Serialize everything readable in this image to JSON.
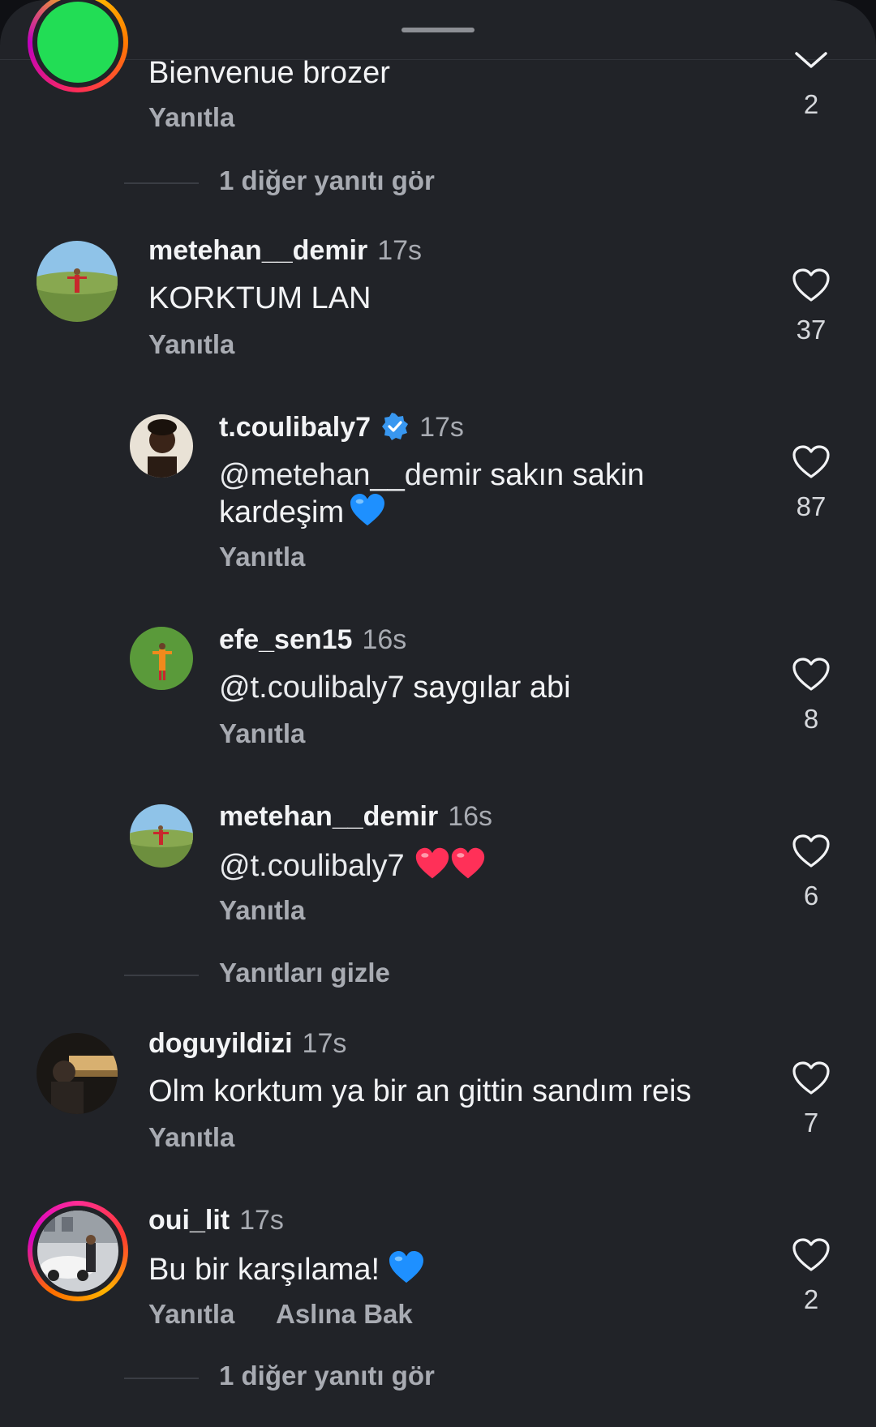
{
  "sheet": {
    "background": "#212328"
  },
  "colors": {
    "secondary_text": "#a8abb2",
    "verified_blue": "#3897f0",
    "heart_red": "#ff3040",
    "heart_blue": "#1e90ff"
  },
  "top_comment": {
    "text": "Bienvenue brozer",
    "reply_label": "Yanıtla",
    "likes": "2"
  },
  "view_more_1": "1 diğer yanıtı gör",
  "comments": [
    {
      "username": "metehan__demir",
      "time": "17s",
      "text": "KORKTUM LAN",
      "reply_label": "Yanıtla",
      "likes": "37"
    },
    {
      "username": "t.coulibaly7",
      "verified": true,
      "time": "17s",
      "mention": "@metehan__demir",
      "text_rest": " sakın sakin",
      "text_line2": "kardeşim",
      "emoji": "blue-heart",
      "reply_label": "Yanıtla",
      "likes": "87"
    },
    {
      "username": "efe_sen15",
      "time": "16s",
      "mention": "@t.coulibaly7",
      "text_rest": " saygılar abi",
      "reply_label": "Yanıtla",
      "likes": "8"
    },
    {
      "username": "metehan__demir",
      "time": "16s",
      "mention": "@t.coulibaly7",
      "emoji": "red-hearts",
      "reply_label": "Yanıtla",
      "likes": "6"
    }
  ],
  "hide_replies": "Yanıtları gizle",
  "comments2": [
    {
      "username": "doguyildizi",
      "time": "17s",
      "text": "Olm korktum ya bir an gittin sandım reis",
      "reply_label": "Yanıtla",
      "likes": "7"
    },
    {
      "username": "oui_lit",
      "time": "17s",
      "text": "Bu bir karşılama!",
      "emoji": "blue-heart",
      "reply_label": "Yanıtla",
      "see_original": "Aslına Bak",
      "likes": "2"
    }
  ],
  "view_more_2": "1 diğer yanıtı gör"
}
